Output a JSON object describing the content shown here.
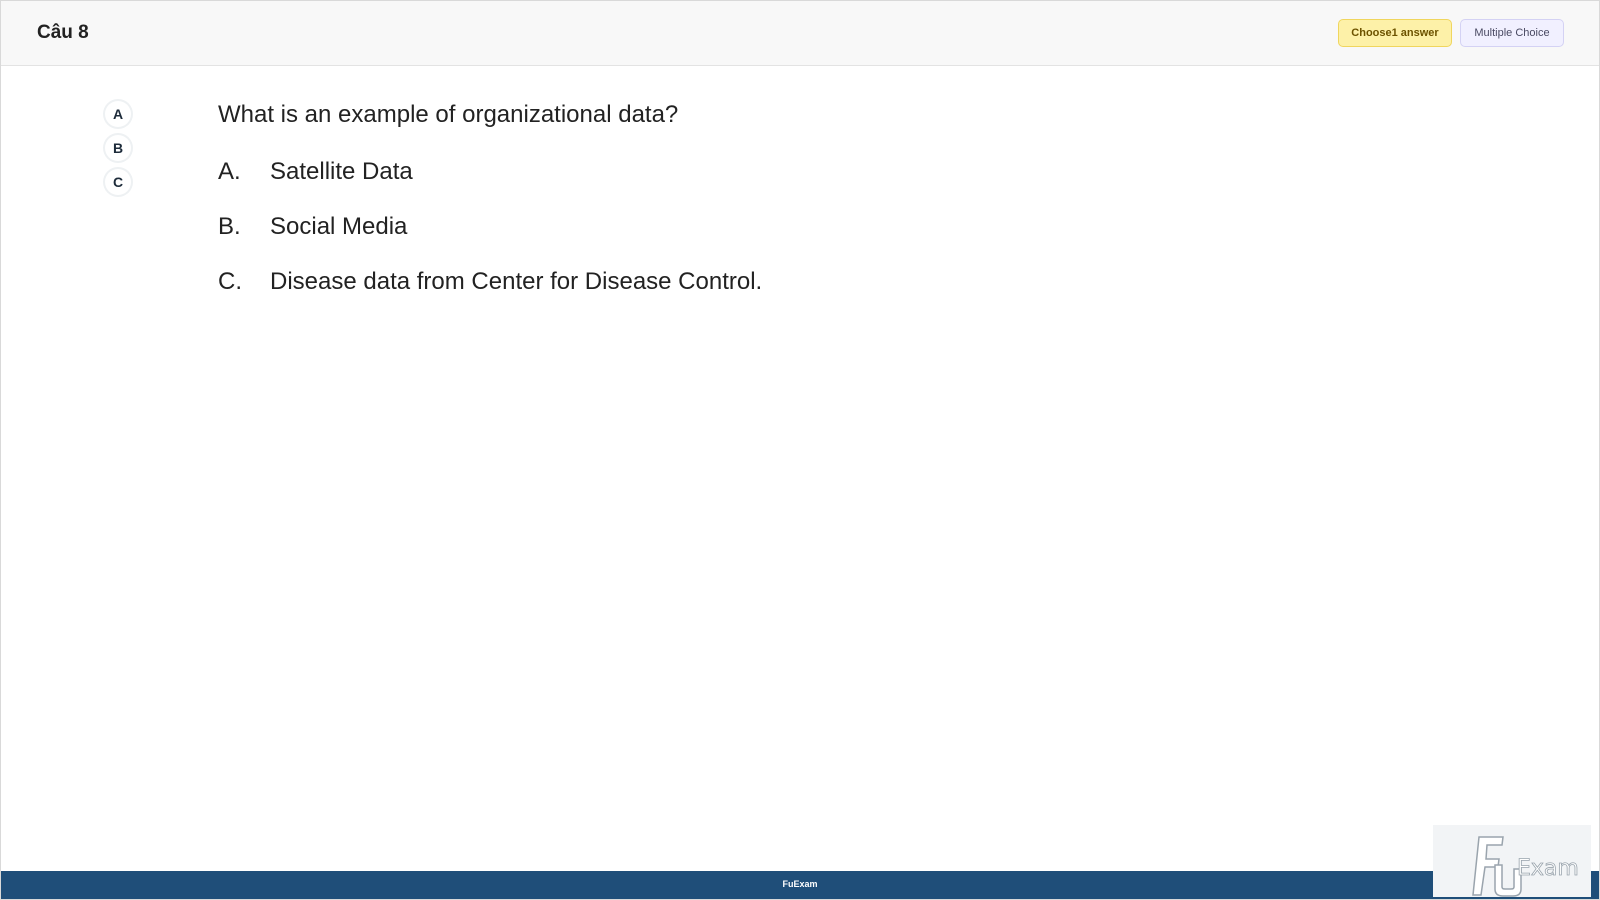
{
  "header": {
    "title": "Câu 8",
    "choose_badge": "Choose1 answer",
    "type_badge": "Multiple Choice"
  },
  "option_bubbles": [
    "A",
    "B",
    "C"
  ],
  "question": {
    "text": "What is an example of organizational data?",
    "answers": [
      {
        "letter": "A.",
        "text": "Satellite Data"
      },
      {
        "letter": "B.",
        "text": "Social Media"
      },
      {
        "letter": "C.",
        "text": "Disease data from Center for Disease Control."
      }
    ]
  },
  "footer": {
    "label": "FuExam"
  },
  "logo": {
    "text": "FU Exam"
  }
}
